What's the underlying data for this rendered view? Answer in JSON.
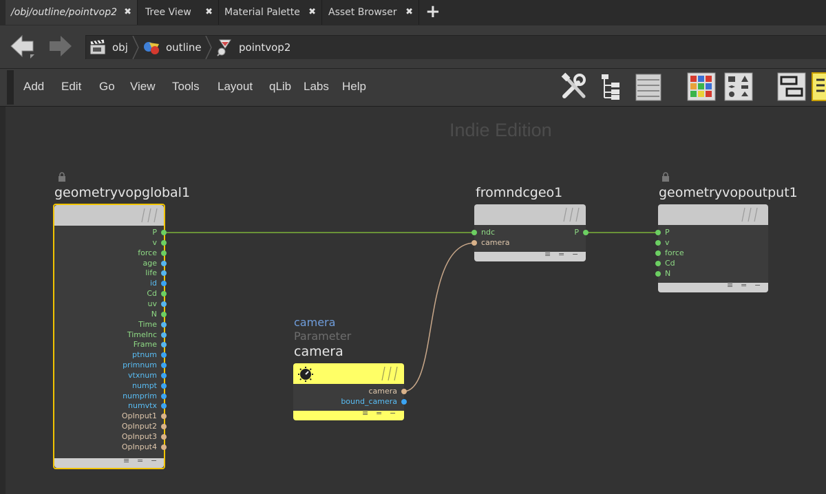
{
  "tabs": [
    {
      "label": "/obj/outline/pointvop2",
      "active": true
    },
    {
      "label": "Tree View"
    },
    {
      "label": "Material Palette"
    },
    {
      "label": "Asset Browser"
    }
  ],
  "tab_close_glyph": "✖",
  "tab_add_glyph": "+",
  "breadcrumb": [
    "obj",
    "outline",
    "pointvop2"
  ],
  "menu": [
    "Add",
    "Edit",
    "Go",
    "View",
    "Tools",
    "Layout",
    "qLib",
    "Labs",
    "Help"
  ],
  "toolbar_icons": [
    "wrench-icon",
    "tree-icon",
    "list-icon",
    "palette-grid-icon",
    "shapes-grid-icon",
    "network-box-icon",
    "notes-icon"
  ],
  "watermark": "Indie Edition",
  "nodes": {
    "global": {
      "name": "geometryvopglobal1",
      "outputs": [
        "P",
        "v",
        "force",
        "age",
        "life",
        "id",
        "Cd",
        "uv",
        "N",
        "Time",
        "TimeInc",
        "Frame",
        "ptnum",
        "primnum",
        "vtxnum",
        "numpt",
        "numprim",
        "numvtx",
        "OpInput1",
        "OpInput2",
        "OpInput3",
        "OpInput4"
      ]
    },
    "fromndc": {
      "name": "fromndcgeo1",
      "inputs": [
        "ndc",
        "camera"
      ],
      "outputs": [
        "P"
      ]
    },
    "output": {
      "name": "geometryvopoutput1",
      "inputs": [
        "P",
        "v",
        "force",
        "Cd",
        "N"
      ]
    },
    "camera": {
      "param_name": "camera",
      "type_label": "Parameter",
      "name": "camera",
      "outputs": [
        "camera",
        "bound_camera"
      ]
    }
  },
  "footer_glyphs": [
    "≡",
    "=",
    "−"
  ],
  "colors": {
    "vector_port": "#6ccf62",
    "float_port": "#56b6f0",
    "int_port": "#3ba4f2",
    "string_port": "#d9b28a",
    "selected_border": "#f2c400",
    "parameter_node": "#ffff66"
  }
}
